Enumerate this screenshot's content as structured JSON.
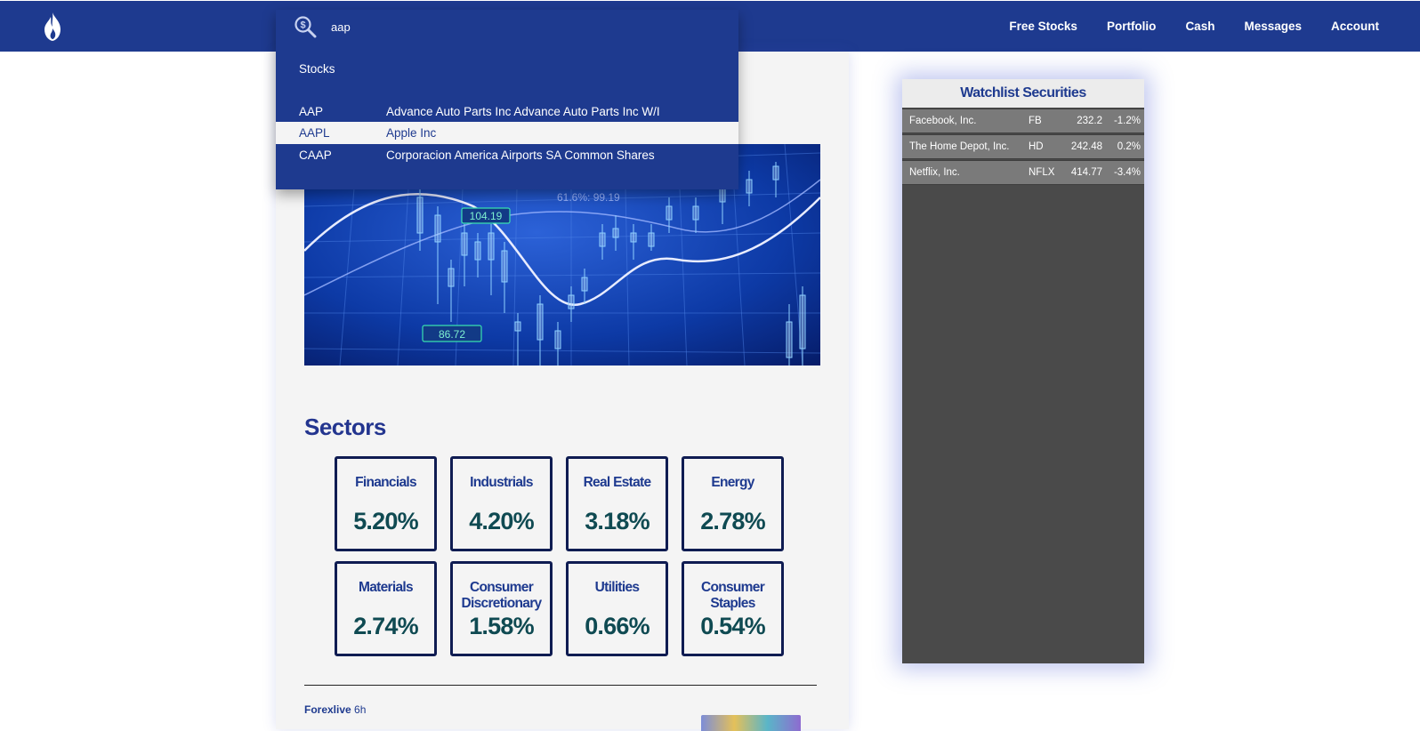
{
  "nav": {
    "items": [
      "Free Stocks",
      "Portfolio",
      "Cash",
      "Messages",
      "Account"
    ]
  },
  "search": {
    "query": "aap",
    "group_label": "Stocks",
    "results": [
      {
        "symbol": "AAP",
        "name": "Advance Auto Parts Inc Advance Auto Parts Inc W/I"
      },
      {
        "symbol": "AAPL",
        "name": "Apple Inc"
      },
      {
        "symbol": "CAAP",
        "name": "Corporacion America Airports SA Common Shares"
      }
    ],
    "selected_index": 1
  },
  "hero": {
    "labels": [
      "61.6%: 99.19",
      "104.19",
      "86.72"
    ]
  },
  "sectors": {
    "title": "Sectors",
    "items": [
      {
        "name": "Financials",
        "value": "5.20%"
      },
      {
        "name": "Industrials",
        "value": "4.20%"
      },
      {
        "name": "Real Estate",
        "value": "3.18%"
      },
      {
        "name": "Energy",
        "value": "2.78%"
      },
      {
        "name": "Materials",
        "value": "2.74%"
      },
      {
        "name": "Consumer Discretionary",
        "value": "1.58%"
      },
      {
        "name": "Utilities",
        "value": "0.66%"
      },
      {
        "name": "Consumer Staples",
        "value": "0.54%"
      }
    ]
  },
  "news": {
    "source": "Forexlive",
    "time": "6h"
  },
  "watchlist": {
    "title": "Watchlist Securities",
    "rows": [
      {
        "name": "Facebook, Inc.",
        "symbol": "FB",
        "price": "232.2",
        "change": "-1.2%"
      },
      {
        "name": "The Home Depot, Inc.",
        "symbol": "HD",
        "price": "242.48",
        "change": "0.2%"
      },
      {
        "name": "Netflix, Inc.",
        "symbol": "NFLX",
        "price": "414.77",
        "change": "-3.4%"
      }
    ]
  },
  "colors": {
    "brand": "#1e3a8f",
    "sector_value": "#0f4a52",
    "panel": "#f4f4f4"
  }
}
